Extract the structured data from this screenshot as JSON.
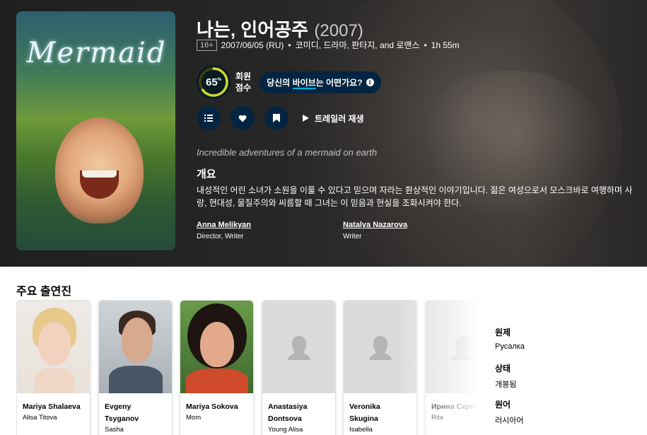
{
  "movie": {
    "title": "나는, 인어공주",
    "year": "(2007)",
    "certification": "16+",
    "release": "2007/06/05 (RU)",
    "genres": "코미디, 드라마, 판타지, and 로맨스",
    "runtime": "1h 55m",
    "score": "65",
    "score_pct": "%",
    "score_label_1": "회원",
    "score_label_2": "점수",
    "vibe_prefix": "당신의 ",
    "vibe_highlight": "바이브",
    "vibe_suffix": "는 어떤가요?",
    "trailer_label": "트레일러 재생",
    "tagline": "Incredible adventures of a mermaid on earth",
    "overview_heading": "개요",
    "overview": "내성적인 어린 소녀가 소원을 이룰 수 있다고 믿으며 자라는 환상적인 이야기입니다. 젊은 여성으로서 모스크바로 여행하며 사랑, 현대성, 물질주의와 씨름할 때 그녀는 이 믿음과 현실을 조화시켜야 한다.",
    "poster_text": "Mermaid",
    "crew": [
      {
        "name": "Anna Melikyan",
        "job": "Director, Writer"
      },
      {
        "name": "Natalya Nazarova",
        "job": "Writer"
      }
    ]
  },
  "cast_heading": "주요 출연진",
  "cast": [
    {
      "name": "Mariya Shalaeva",
      "role": "Alisa Titova"
    },
    {
      "name": "Evgeny Tsyganov",
      "role": "Sasha"
    },
    {
      "name": "Mariya Sokova",
      "role": "Mom"
    },
    {
      "name": "Anastasiya Dontsova",
      "role": "Young Alisa"
    },
    {
      "name": "Veronika Skugina",
      "role": "Isabella"
    },
    {
      "name": "Ирина Скриниченко",
      "role": "Rita"
    }
  ],
  "facts": [
    {
      "label": "원제",
      "value": "Русалка"
    },
    {
      "label": "상태",
      "value": "개봉됨"
    },
    {
      "label": "원어",
      "value": "러시아어"
    }
  ],
  "colors": {
    "navy": "#032541",
    "score_ring": "#d2d531",
    "score_track": "#423d0f",
    "accent": "#01b4e4"
  }
}
